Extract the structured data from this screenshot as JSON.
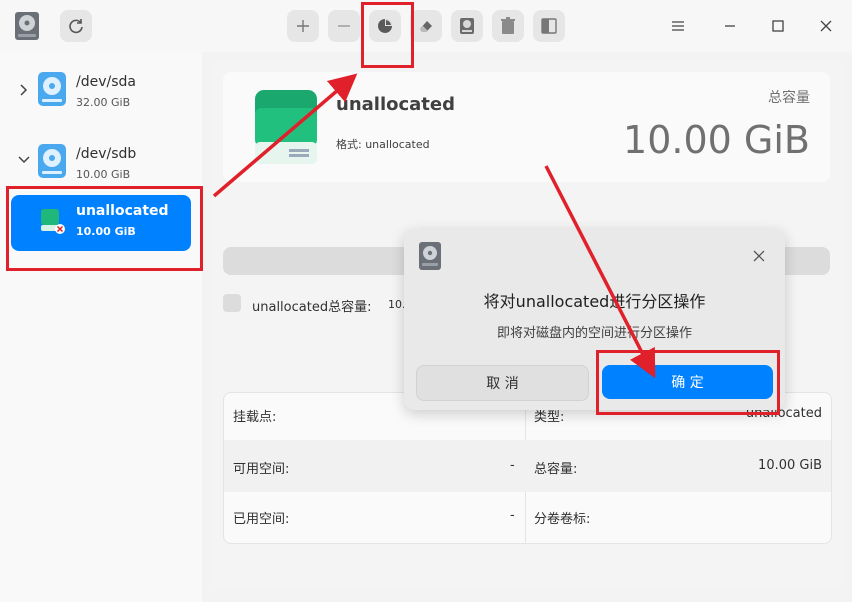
{
  "toolbar": {
    "buttons": [
      {
        "name": "add-partition",
        "icon": "plus-icon"
      },
      {
        "name": "remove-partition",
        "icon": "minus-icon"
      },
      {
        "name": "partition",
        "icon": "pie-chart-icon"
      },
      {
        "name": "format",
        "icon": "eraser-icon"
      },
      {
        "name": "mount",
        "icon": "disk-icon"
      },
      {
        "name": "unmount",
        "icon": "trash-icon"
      },
      {
        "name": "resize",
        "icon": "resize-icon"
      }
    ],
    "menu_icon": "menu-icon",
    "minimize_icon": "minimize-icon",
    "maximize_icon": "maximize-icon",
    "close_icon": "close-icon"
  },
  "sidebar": {
    "disks": [
      {
        "name": "/dev/sda",
        "size": "32.00 GiB"
      },
      {
        "name": "/dev/sdb",
        "size": "10.00 GiB"
      }
    ],
    "selected": {
      "name": "unallocated",
      "size": "10.00 GiB"
    }
  },
  "info": {
    "title": "unallocated",
    "format_label": "格式: unallocated",
    "capacity_label": "总容量",
    "capacity_value": "10.00 GiB"
  },
  "legend": {
    "label": "unallocated总容量:",
    "value": "10."
  },
  "table": {
    "rows": [
      {
        "left_label": "挂载点:",
        "left_value": "",
        "right_label": "类型:",
        "right_value": "unallocated"
      },
      {
        "left_label": "可用空间:",
        "left_value": "-",
        "right_label": "总容量:",
        "right_value": "10.00 GiB"
      },
      {
        "left_label": "已用空间:",
        "left_value": "-",
        "right_label": "分卷卷标:",
        "right_value": ""
      }
    ]
  },
  "dialog": {
    "title": "将对unallocated进行分区操作",
    "message": "即将对磁盘内的空间进行分区操作",
    "cancel_label": "取 消",
    "ok_label": "确 定"
  },
  "colors": {
    "accent": "#0081ff",
    "annotation": "#e0202a"
  }
}
